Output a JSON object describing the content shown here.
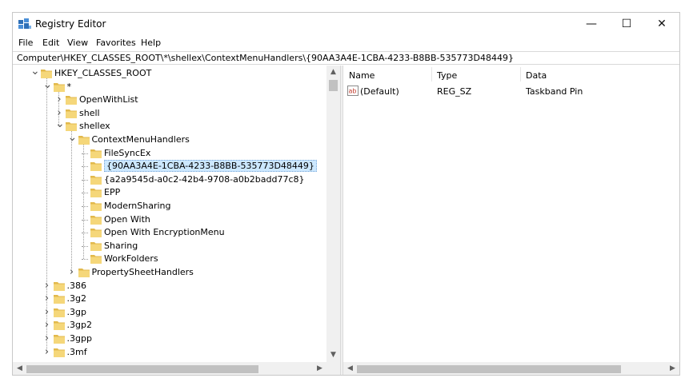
{
  "window": {
    "title": "Registry Editor",
    "minimize": "—",
    "maximize": "☐",
    "close": "✕"
  },
  "menu": [
    "File",
    "Edit",
    "View",
    "Favorites",
    "Help"
  ],
  "address": "Computer\\HKEY_CLASSES_ROOT\\*\\shellex\\ContextMenuHandlers\\{90AA3A4E-1CBA-4233-B8BB-535773D48449}",
  "tree": [
    {
      "label": "HKEY_CLASSES_ROOT",
      "depth": 0,
      "expander": "expanded"
    },
    {
      "label": "*",
      "depth": 1,
      "expander": "expanded"
    },
    {
      "label": "OpenWithList",
      "depth": 2,
      "expander": "collapsed"
    },
    {
      "label": "shell",
      "depth": 2,
      "expander": "collapsed"
    },
    {
      "label": "shellex",
      "depth": 2,
      "expander": "expanded"
    },
    {
      "label": "ContextMenuHandlers",
      "depth": 3,
      "expander": "expanded"
    },
    {
      "label": "FileSyncEx",
      "depth": 4,
      "expander": "none"
    },
    {
      "label": "{90AA3A4E-1CBA-4233-B8BB-535773D48449}",
      "depth": 4,
      "expander": "none",
      "selected": true
    },
    {
      "label": "{a2a9545d-a0c2-42b4-9708-a0b2badd77c8}",
      "depth": 4,
      "expander": "none"
    },
    {
      "label": "EPP",
      "depth": 4,
      "expander": "none"
    },
    {
      "label": "ModernSharing",
      "depth": 4,
      "expander": "none"
    },
    {
      "label": "Open With",
      "depth": 4,
      "expander": "none"
    },
    {
      "label": "Open With EncryptionMenu",
      "depth": 4,
      "expander": "none"
    },
    {
      "label": "Sharing",
      "depth": 4,
      "expander": "none"
    },
    {
      "label": "WorkFolders",
      "depth": 4,
      "expander": "none"
    },
    {
      "label": "PropertySheetHandlers",
      "depth": 3,
      "expander": "collapsed"
    },
    {
      "label": ".386",
      "depth": 1,
      "expander": "collapsed"
    },
    {
      "label": ".3g2",
      "depth": 1,
      "expander": "collapsed"
    },
    {
      "label": ".3gp",
      "depth": 1,
      "expander": "collapsed"
    },
    {
      "label": ".3gp2",
      "depth": 1,
      "expander": "collapsed"
    },
    {
      "label": ".3gpp",
      "depth": 1,
      "expander": "collapsed"
    },
    {
      "label": ".3mf",
      "depth": 1,
      "expander": "collapsed"
    }
  ],
  "values": {
    "columns": [
      "Name",
      "Type",
      "Data"
    ],
    "rows": [
      {
        "icon": "string-value-icon",
        "name": "(Default)",
        "type": "REG_SZ",
        "data": "Taskband Pin"
      }
    ]
  },
  "colors": {
    "folder": "#f5d77a",
    "folder_dark": "#e2b94c",
    "selection": "#cce8ff",
    "icon_blue": "#2e6fb7"
  }
}
